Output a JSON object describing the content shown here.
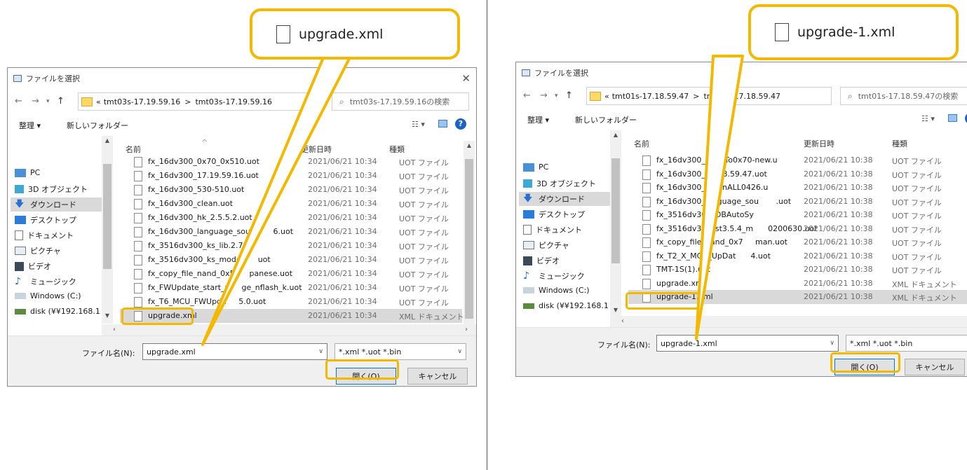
{
  "left": {
    "callout": {
      "text": "upgrade.xml"
    },
    "title": "ファイルを選択",
    "address": {
      "prefix": "«",
      "crumb1": "tmt03s-17.19.59.16",
      "sep": ">",
      "crumb2": "tmt03s-17.19.59.16"
    },
    "search_placeholder": "tmt03s-17.19.59.16の検索",
    "toolbar": {
      "organize": "整理 ▾",
      "new_folder": "新しいフォルダー"
    },
    "nav": [
      "PC",
      "3D オブジェクト",
      "ダウンロード",
      "デスクトップ",
      "ドキュメント",
      "ピクチャ",
      "ビデオ",
      "ミュージック",
      "Windows (C:)",
      "disk (¥¥192.168.1"
    ],
    "headers": {
      "name": "名前",
      "date": "更新日時",
      "type": "種類"
    },
    "files": [
      {
        "name": "fx_16dv300_0x70_0x510.uot",
        "date": "2021/06/21 10:34",
        "type": "UOT ファイル"
      },
      {
        "name": "fx_16dv300_17.19.59.16.uot",
        "date": "2021/06/21 10:34",
        "type": "UOT ファイル"
      },
      {
        "name": "fx_16dv300_530-510.uot",
        "date": "2021/06/21 10:34",
        "type": "UOT ファイル"
      },
      {
        "name": "fx_16dv300_clean.uot",
        "date": "2021/06/21 10:34",
        "type": "UOT ファイル"
      },
      {
        "name": "fx_16dv300_hk_2.5.5.2.uot",
        "date": "2021/06/21 10:34",
        "type": "UOT ファイル"
      },
      {
        "name": "fx_16dv300_language_sour        6.uot",
        "date": "2021/06/21 10:34",
        "type": "UOT ファイル"
      },
      {
        "name": "fx_3516dv300_ks_lib.2.7.3",
        "date": "2021/06/21 10:34",
        "type": "UOT ファイル"
      },
      {
        "name": "fx_3516dv300_ks_model      uot",
        "date": "2021/06/21 10:34",
        "type": "UOT ファイル"
      },
      {
        "name": "fx_copy_file_nand_0x5      panese.uot",
        "date": "2021/06/21 10:34",
        "type": "UOT ファイル"
      },
      {
        "name": "fx_FWUpdate_start_ul    ge_nflash_k.uot",
        "date": "2021/06/21 10:34",
        "type": "UOT ファイル"
      },
      {
        "name": "fx_T6_MCU_FWUpda     5.0.uot",
        "date": "2021/06/21 10:34",
        "type": "UOT ファイル"
      },
      {
        "name": "upgrade.xml",
        "date": "2021/06/21 10:34",
        "type": "XML ドキュメント"
      }
    ],
    "selected_index": 11,
    "filename_label": "ファイル名(N):",
    "filename_value": "upgrade.xml",
    "filetype": "*.xml *.uot *.bin",
    "open_button": "開く(O)",
    "cancel_button": "キャンセル"
  },
  "right": {
    "callout": {
      "text": "upgrade-1.xml"
    },
    "title": "ファイルを選択",
    "address": {
      "prefix": "«",
      "crumb1": "tmt01s-17.18.59.47",
      "sep": ">",
      "crumb2": "tmt01s-17.18.59.47"
    },
    "search_placeholder": "tmt01s-17.18.59.47の検索",
    "toolbar": {
      "organize": "整理 ▾",
      "new_folder": "新しいフォルダー"
    },
    "nav": [
      "PC",
      "3D オブジェクト",
      "ダウンロード",
      "デスクトップ",
      "ドキュメント",
      "ピクチャ",
      "ビデオ",
      "ミュージック",
      "Windows (C:)",
      "disk (¥¥192.168.1"
    ],
    "headers": {
      "name": "名前",
      "date": "更新日時",
      "type": "種類"
    },
    "files": [
      {
        "name": "fx_16dv300_0x30To0x70-new.u",
        "date": "2021/06/21 10:38",
        "type": "UOT ファイル"
      },
      {
        "name": "fx_16dv300_17.18.59.47.uot",
        "date": "2021/06/21 10:38",
        "type": "UOT ファイル"
      },
      {
        "name": "fx_16dv300_CleanALL0426.u",
        "date": "2021/06/21 10:38",
        "type": "UOT ファイル"
      },
      {
        "name": "fx_16dv300_language_sou       .uot",
        "date": "2021/06/21 10:38",
        "type": "UOT ファイル"
      },
      {
        "name": "fx_3516dv300_DBAutoSy",
        "date": "2021/06/21 10:38",
        "type": "UOT ファイル"
      },
      {
        "name": "fx_3516dv300_st3.5.4_m      0200630.uot",
        "date": "2021/06/21 10:38",
        "type": "UOT ファイル"
      },
      {
        "name": "fx_copy_file_nand_0x7     man.uot",
        "date": "2021/06/21 10:38",
        "type": "UOT ファイル"
      },
      {
        "name": "fx_T2_X_MCU_UpDat      4.uot",
        "date": "2021/06/21 10:38",
        "type": "UOT ファイル"
      },
      {
        "name": "TMT-1S(1).uot",
        "date": "2021/06/21 10:38",
        "type": "UOT ファイル"
      },
      {
        "name": "upgrade.xml",
        "date": "2021/06/21 10:38",
        "type": "XML ドキュメント"
      },
      {
        "name": "upgrade-1.xml",
        "date": "2021/06/21 10:38",
        "type": "XML ドキュメント"
      }
    ],
    "selected_index": 10,
    "filename_label": "ファイル名(N):",
    "filename_value": "upgrade-1.xml",
    "filetype": "*.xml *.uot *.bin",
    "open_button": "開く(O)",
    "cancel_button": "キャンセル"
  },
  "colors": {
    "highlight": "#f5b800",
    "selection": "#d9d9d9",
    "accent": "#0078d7"
  }
}
